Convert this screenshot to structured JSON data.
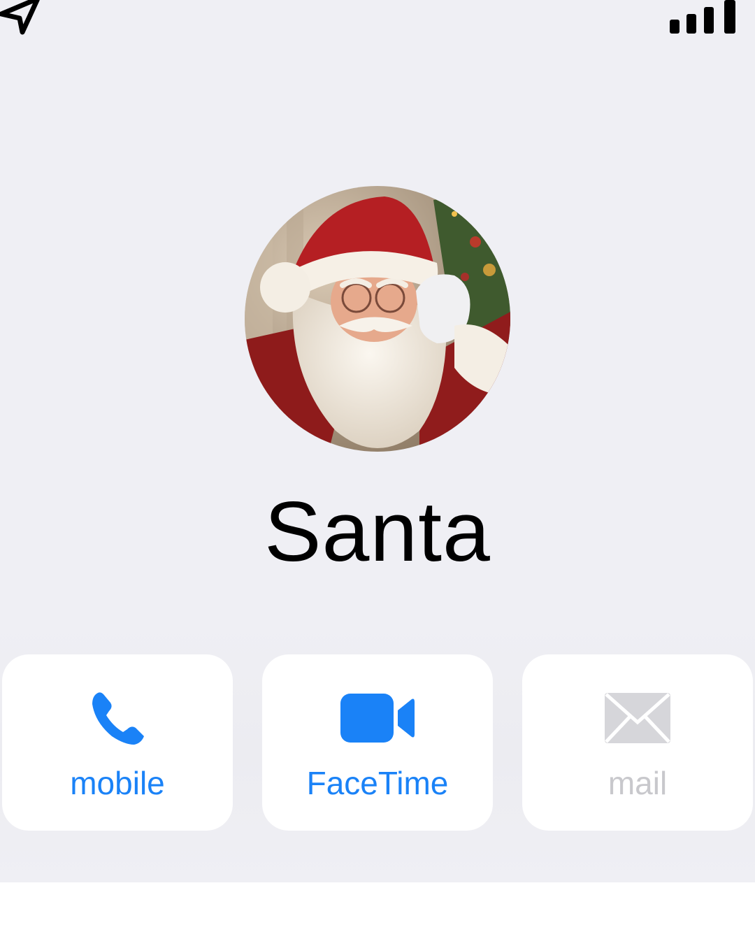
{
  "status_bar": {
    "left_icon": "location-arrow-icon",
    "right_icon": "cellular-signal-icon"
  },
  "contact": {
    "name": "Santa",
    "photo": "santa-claus-photo"
  },
  "actions": [
    {
      "id": "mobile",
      "label": "mobile",
      "icon": "phone-icon",
      "enabled": true,
      "color": "#1a82f7"
    },
    {
      "id": "facetime",
      "label": "FaceTime",
      "icon": "video-camera-icon",
      "enabled": true,
      "color": "#1a82f7"
    },
    {
      "id": "mail",
      "label": "mail",
      "icon": "envelope-icon",
      "enabled": false,
      "color": "#c8c8cc"
    }
  ],
  "colors": {
    "background": "#efeff4",
    "card": "#ffffff",
    "accent": "#1a82f7",
    "disabled": "#c8c8cc",
    "text": "#000000"
  }
}
